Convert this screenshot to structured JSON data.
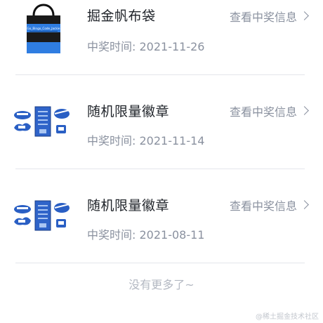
{
  "prizes": [
    {
      "name": "掘金帆布袋",
      "time": "中奖时间: 2021-11-26",
      "action": "查看中奖信息",
      "image": "tote-bag",
      "bag_text": "Go_Bingo_Code_Jackie"
    },
    {
      "name": "随机限量徽章",
      "time": "中奖时间: 2021-11-14",
      "action": "查看中奖信息",
      "image": "badge-set"
    },
    {
      "name": "随机限量徽章",
      "time": "中奖时间: 2021-08-11",
      "action": "查看中奖信息",
      "image": "badge-set"
    }
  ],
  "footer": {
    "text": "没有更多了~"
  },
  "watermark": {
    "text": "@稀土掘金技术社区"
  },
  "colors": {
    "brand_blue": "#1e80ff",
    "text_primary": "#1f2329",
    "text_secondary": "#8a919f",
    "divider": "#e4e6eb"
  }
}
